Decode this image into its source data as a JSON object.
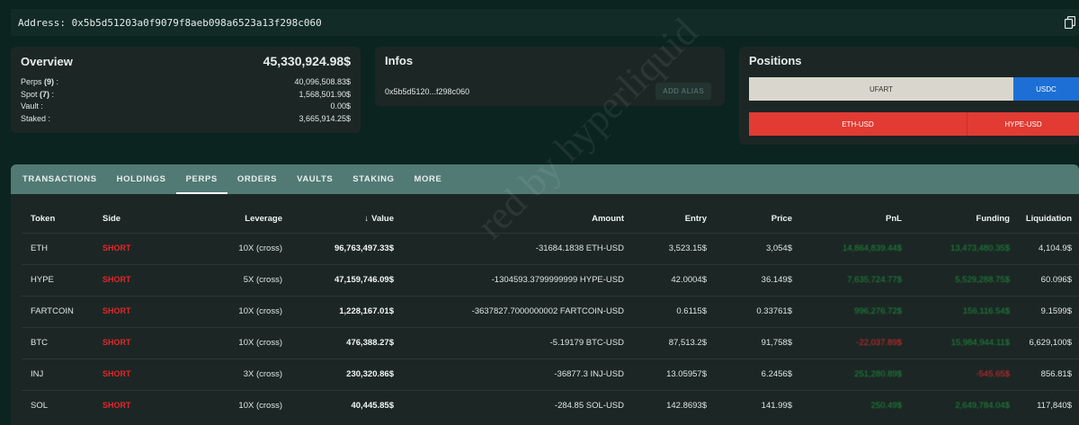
{
  "address_bar": {
    "label": "Address:",
    "value": "0x5b5d51203a0f9079f8aeb098a6523a13f298c060"
  },
  "overview": {
    "title": "Overview",
    "total": "45,330,924.98$",
    "rows": [
      {
        "label": "Perps",
        "count": "(9)",
        "suffix": " :",
        "value": "40,096,508.83$"
      },
      {
        "label": "Spot",
        "count": "(7)",
        "suffix": " :",
        "value": "1,568,501.90$"
      },
      {
        "label": "Vault :",
        "count": "",
        "suffix": "",
        "value": "0.00$"
      },
      {
        "label": "Staked :",
        "count": "",
        "suffix": "",
        "value": "3,665,914.25$"
      }
    ]
  },
  "infos": {
    "title": "Infos",
    "address_short": "0x5b5d5120...f298c060",
    "alias_button": "ADD ALIAS"
  },
  "positions": {
    "title": "Positions",
    "bar1": [
      {
        "label": "UFART",
        "color": "#d9d7cd"
      },
      {
        "label": "USDC",
        "color": "#1d6fd6"
      }
    ],
    "bar2": [
      {
        "label": "ETH-USD",
        "color": "#e23b33"
      },
      {
        "label": "HYPE-USD",
        "color": "#e23b33"
      }
    ]
  },
  "tabs": [
    "TRANSACTIONS",
    "HOLDINGS",
    "PERPS",
    "ORDERS",
    "VAULTS",
    "STAKING",
    "MORE"
  ],
  "active_tab": "PERPS",
  "table": {
    "headers": {
      "token": "Token",
      "side": "Side",
      "leverage": "Leverage",
      "value": "Value",
      "amount": "Amount",
      "entry": "Entry",
      "price": "Price",
      "pnl": "PnL",
      "funding": "Funding",
      "liquidation": "Liquidation"
    },
    "sort_arrow": "↓",
    "rows": [
      {
        "token": "ETH",
        "side": "SHORT",
        "leverage": "10X (cross)",
        "value": "96,763,497.33$",
        "amount": "-31684.1838 ETH-USD",
        "entry": "3,523.15$",
        "price": "3,054$",
        "pnl": "14,864,839.44$",
        "pnl_sign": "pos",
        "funding": "13,473,480.35$",
        "funding_sign": "pos",
        "liquidation": "4,104.9$"
      },
      {
        "token": "HYPE",
        "side": "SHORT",
        "leverage": "5X (cross)",
        "value": "47,159,746.09$",
        "amount": "-1304593.3799999999 HYPE-USD",
        "entry": "42.0004$",
        "price": "36.149$",
        "pnl": "7,635,724.77$",
        "pnl_sign": "pos",
        "funding": "5,529,288.75$",
        "funding_sign": "pos",
        "liquidation": "60.096$"
      },
      {
        "token": "FARTCOIN",
        "side": "SHORT",
        "leverage": "10X (cross)",
        "value": "1,228,167.01$",
        "amount": "-3637827.7000000002 FARTCOIN-USD",
        "entry": "0.6115$",
        "price": "0.33761$",
        "pnl": "996,276.72$",
        "pnl_sign": "pos",
        "funding": "156,116.54$",
        "funding_sign": "pos",
        "liquidation": "9.1599$"
      },
      {
        "token": "BTC",
        "side": "SHORT",
        "leverage": "10X (cross)",
        "value": "476,388.27$",
        "amount": "-5.19179 BTC-USD",
        "entry": "87,513.2$",
        "price": "91,758$",
        "pnl": "-22,037.89$",
        "pnl_sign": "neg",
        "funding": "15,984,944.11$",
        "funding_sign": "pos",
        "liquidation": "6,629,100$"
      },
      {
        "token": "INJ",
        "side": "SHORT",
        "leverage": "3X (cross)",
        "value": "230,320.86$",
        "amount": "-36877.3 INJ-USD",
        "entry": "13.05957$",
        "price": "6.2456$",
        "pnl": "251,280.89$",
        "pnl_sign": "pos",
        "funding": "-545.65$",
        "funding_sign": "neg",
        "liquidation": "856.81$"
      },
      {
        "token": "SOL",
        "side": "SHORT",
        "leverage": "10X (cross)",
        "value": "40,445.85$",
        "amount": "-284.85 SOL-USD",
        "entry": "142.8693$",
        "price": "141.99$",
        "pnl": "250.49$",
        "pnl_sign": "pos",
        "funding": "2,649,784.04$",
        "funding_sign": "pos",
        "liquidation": "117,840$"
      }
    ]
  },
  "watermark": "red by hyperliquid"
}
